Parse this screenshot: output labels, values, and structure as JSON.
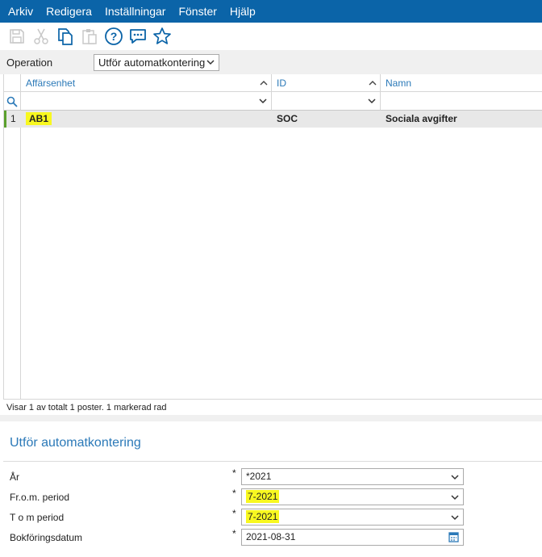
{
  "menu": [
    "Arkiv",
    "Redigera",
    "Inställningar",
    "Fönster",
    "Hjälp"
  ],
  "toolbar": {
    "icons": [
      "save-icon",
      "cut-icon",
      "copy-icon",
      "paste-icon",
      "help-icon",
      "chat-icon",
      "favorite-star-icon"
    ]
  },
  "operation": {
    "label": "Operation",
    "value": "Utför automatkontering"
  },
  "grid": {
    "columns": [
      "Affärsenhet",
      "ID",
      "Namn"
    ],
    "rows": [
      {
        "num": "1",
        "affarsenhet": "AB1",
        "id": "SOC",
        "namn": "Sociala avgifter"
      }
    ],
    "status": "Visar 1 av totalt 1 poster. 1 markerad rad"
  },
  "form": {
    "title": "Utför automatkontering",
    "required_mark": "*",
    "fields": [
      {
        "label": "År",
        "value": "*2021"
      },
      {
        "label": "Fr.o.m. period",
        "value": "7-2021"
      },
      {
        "label": "T o m period",
        "value": "7-2021"
      },
      {
        "label": "Bokföringsdatum",
        "value": "2021-08-31"
      }
    ]
  },
  "colors": {
    "menubar": "#0b64a8",
    "accent": "#2b79b8",
    "highlight": "#f8f820",
    "selected_row": "#e8e8e8"
  }
}
